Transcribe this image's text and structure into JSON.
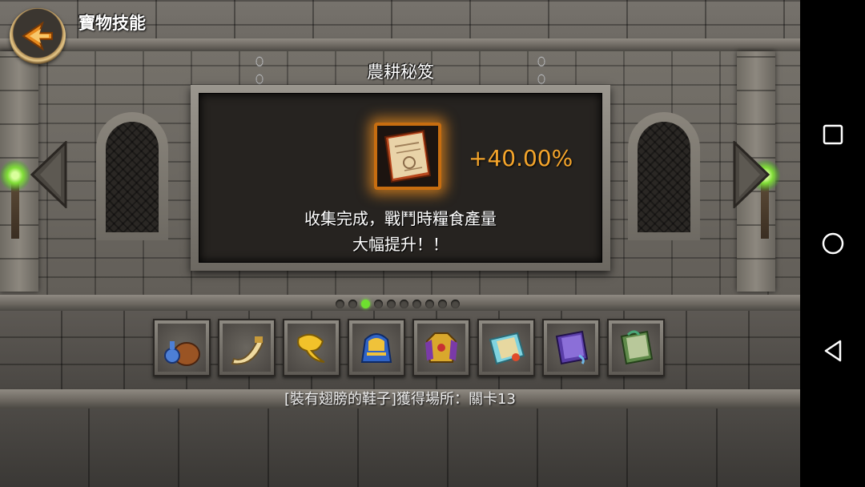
{
  "header": {
    "title": "寶物技能"
  },
  "sign": {
    "title": "農耕秘笈",
    "bonus": "+40.00%",
    "description_line1": "收集完成，戰鬥時糧食產量",
    "description_line2": "大幅提升！！",
    "icon": "recipe-book-icon"
  },
  "pagination": {
    "total": 10,
    "active_index": 2
  },
  "slots": [
    {
      "icon": "potion-and-pouch-icon"
    },
    {
      "icon": "horn-icon"
    },
    {
      "icon": "golden-leaf-icon"
    },
    {
      "icon": "pharaoh-headdress-icon"
    },
    {
      "icon": "golden-armor-icon"
    },
    {
      "icon": "scroll-map-icon"
    },
    {
      "icon": "purple-book-icon"
    },
    {
      "icon": "green-book-icon"
    }
  ],
  "footer": {
    "location_text": "[裝有翅膀的鞋子]獲得場所：關卡13"
  },
  "android_nav": {
    "buttons": [
      "recent-apps-icon",
      "home-icon",
      "back-icon"
    ]
  },
  "colors": {
    "bonus": "#f5a52b",
    "active_dot": "#6ee02f",
    "frame_glow": "#c76d10"
  }
}
